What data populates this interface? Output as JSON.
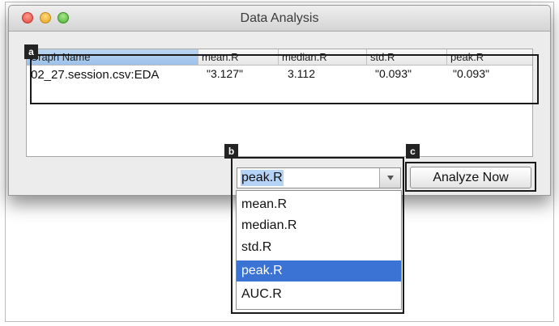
{
  "window": {
    "title": "Data Analysis"
  },
  "table": {
    "columns": [
      "Graph Name",
      "mean.R",
      "median.R",
      "std.R",
      "peak.R"
    ],
    "rows": [
      [
        "02_27.session.csv:EDA",
        "\"3.127\"",
        "3.112",
        "\"0.093\"",
        "\"0.093\""
      ]
    ]
  },
  "metric_select": {
    "value": "peak.R",
    "options": [
      "mean.R",
      "median.R",
      "std.R",
      "peak.R",
      "AUC.R"
    ],
    "highlighted_index": 3
  },
  "analyze_button": {
    "label": "Analyze Now"
  },
  "callouts": {
    "a": "a",
    "b": "b",
    "c": "c"
  },
  "colors": {
    "selection": "#3a73d3",
    "header_selected": "#a9c9ee",
    "callout_bg": "#232323"
  }
}
